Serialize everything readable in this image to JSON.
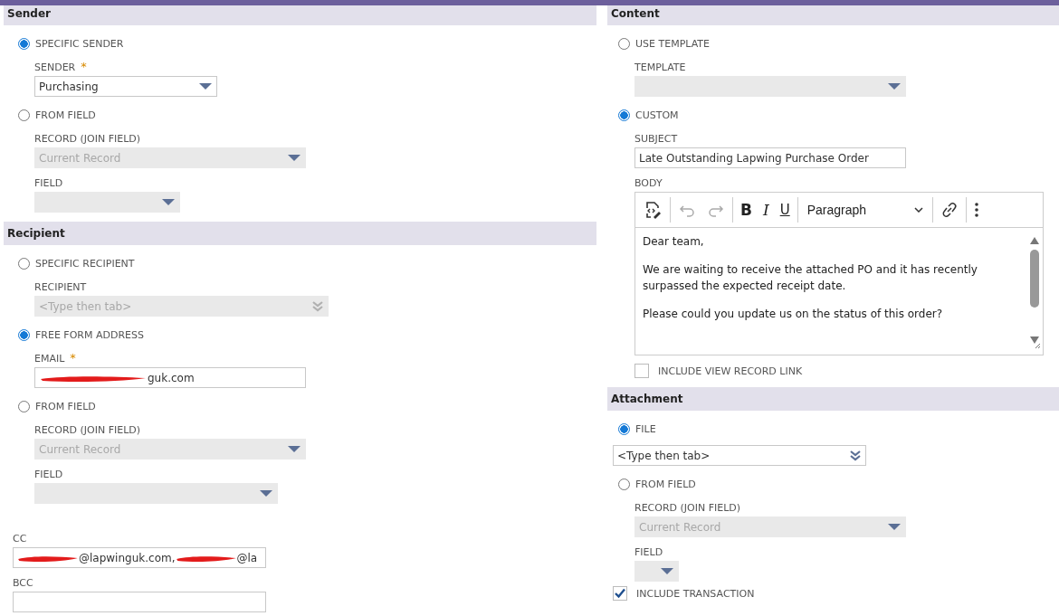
{
  "columns": [
    {
      "sections": [
        {
          "title": "Sender",
          "items": [
            {
              "kind": "radio",
              "label": "SPECIFIC SENDER",
              "selected": true
            },
            {
              "kind": "field",
              "label": "SENDER",
              "required_mark": "*",
              "control": {
                "kind": "select",
                "disabled": false,
                "value": "Purchasing"
              }
            },
            {
              "kind": "radio",
              "label": "FROM FIELD",
              "selected": false
            },
            {
              "kind": "field",
              "label": "RECORD (JOIN FIELD)",
              "control": {
                "kind": "select",
                "disabled": true,
                "value": "Current Record"
              }
            },
            {
              "kind": "field",
              "label": "FIELD",
              "control": {
                "kind": "select",
                "disabled": true
              }
            }
          ]
        },
        {
          "title": "Recipient",
          "items": [
            {
              "kind": "radio",
              "label": "SPECIFIC RECIPIENT",
              "selected": false
            },
            {
              "kind": "field",
              "label": "RECIPIENT",
              "control": {
                "kind": "lookup",
                "disabled": true,
                "placeholder": "<Type then tab>"
              }
            },
            {
              "kind": "radio",
              "label": "FREE FORM ADDRESS",
              "selected": true
            },
            {
              "kind": "field",
              "label": "EMAIL",
              "required_mark": "*",
              "control": {
                "kind": "input",
                "disabled": false,
                "segments": [
                  {
                    "kind": "redacted"
                  },
                  {
                    "kind": "text",
                    "text": "guk.com"
                  }
                ]
              }
            },
            {
              "kind": "radio",
              "label": "FROM FIELD",
              "selected": false
            },
            {
              "kind": "field",
              "label": "RECORD (JOIN FIELD)",
              "control": {
                "kind": "select",
                "disabled": true,
                "value": "Current Record"
              }
            },
            {
              "kind": "field",
              "label": "FIELD",
              "control": {
                "kind": "select",
                "disabled": true
              }
            }
          ],
          "extra_fields": [
            {
              "kind": "plain-field",
              "label": "CC",
              "control": {
                "kind": "input",
                "disabled": false,
                "segments": [
                  {
                    "kind": "redacted"
                  },
                  {
                    "kind": "text",
                    "text": "@lapwinguk.com,"
                  },
                  {
                    "kind": "redacted"
                  },
                  {
                    "kind": "text",
                    "text": "@la"
                  }
                ]
              }
            },
            {
              "kind": "plain-field",
              "label": "BCC",
              "control": {
                "kind": "input",
                "disabled": false
              }
            }
          ]
        }
      ]
    },
    {
      "sections": [
        {
          "title": "Content",
          "items": [
            {
              "kind": "radio",
              "label": "USE TEMPLATE",
              "selected": false
            },
            {
              "kind": "field",
              "label": "TEMPLATE",
              "control": {
                "kind": "select",
                "disabled": true
              }
            },
            {
              "kind": "radio",
              "label": "CUSTOM",
              "selected": true
            },
            {
              "kind": "field",
              "label": "SUBJECT",
              "control": {
                "kind": "input",
                "disabled": false,
                "segments": [
                  {
                    "kind": "text",
                    "text": "Late Outstanding Lapwing Purchase Order"
                  }
                ]
              }
            },
            {
              "kind": "editor",
              "label": "BODY",
              "toolbar": {
                "bold": "B",
                "italic": "I",
                "underline": "U",
                "format": "Paragraph"
              },
              "paragraphs": [
                "Dear team,",
                "We are waiting to receive the attached PO and it has recently surpassed the expected receipt date.",
                "Please could you update us on the status of this order?"
              ]
            },
            {
              "kind": "checkbox",
              "label": "INCLUDE VIEW RECORD LINK",
              "checked": false
            }
          ]
        },
        {
          "title": "Attachment",
          "items": [
            {
              "kind": "radio",
              "label": "FILE",
              "selected": true
            },
            {
              "kind": "plain-field",
              "control": {
                "kind": "lookup",
                "disabled": false,
                "placeholder": "<Type then tab>"
              }
            },
            {
              "kind": "radio",
              "label": "FROM FIELD",
              "selected": false
            },
            {
              "kind": "field",
              "label": "RECORD (JOIN FIELD)",
              "control": {
                "kind": "select",
                "disabled": true,
                "value": "Current Record"
              }
            },
            {
              "kind": "field",
              "label": "FIELD",
              "control": {
                "kind": "select",
                "disabled": true
              }
            },
            {
              "kind": "checkbox",
              "label": "INCLUDE TRANSACTION",
              "checked": true
            }
          ]
        }
      ]
    }
  ]
}
